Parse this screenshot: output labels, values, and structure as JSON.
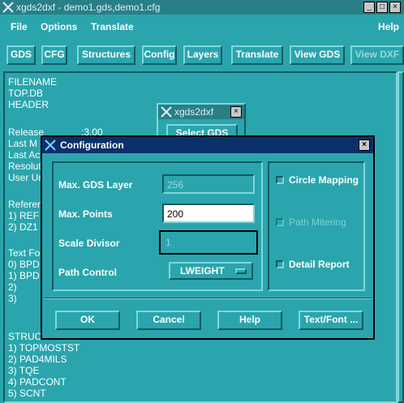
{
  "window": {
    "title": "xgds2dxf - demo1.gds,demo1.cfg"
  },
  "menubar": {
    "file": "File",
    "options": "Options",
    "translate": "Translate",
    "help": "Help"
  },
  "toolbar": [
    "GDS",
    "CFG",
    "Structures",
    "Config",
    "Layers",
    "Translate",
    "View GDS",
    "View DXF"
  ],
  "info": {
    "lines_full": [
      "FILENAME",
      "TOP.DB",
      "",
      "HEADER"
    ],
    "partial_rows": [
      {
        "label": "Release",
        "value": ":3.00"
      },
      {
        "label": "Last M",
        "value": ""
      },
      {
        "label": "Last Ac",
        "value": ""
      },
      {
        "label": "Resolut",
        "value": ""
      },
      {
        "label": "User Ur",
        "value": ""
      }
    ],
    "refs": [
      "Referen",
      "1) REF",
      "2) DZ1"
    ],
    "textfonts": [
      "Text Fo",
      "0) BPD",
      "1) BPD",
      "2)",
      "3)"
    ],
    "structures_header": "STRUCT",
    "structures": [
      "1) TOPMOSTST",
      "2) PAD4MILS",
      "3) TQE",
      "4) PADCONT",
      "5) SCNT"
    ]
  },
  "bg_dialog": {
    "title": "xgds2dxf",
    "button": "Select GDS"
  },
  "config": {
    "title": "Configuration",
    "max_layer_label": "Max. GDS Layer",
    "max_layer_value": "256",
    "max_points_label": "Max. Points",
    "max_points_value": "200",
    "scale_label": "Scale Divisor",
    "scale_value": "1",
    "path_label": "Path Control",
    "path_value": "LWEIGHT",
    "circle_mapping": "Circle Mapping",
    "path_mitering": "Path Mitering",
    "detail_report": "Detail Report",
    "ok": "OK",
    "cancel": "Cancel",
    "help": "Help",
    "textfont": "Text/Font ..."
  }
}
